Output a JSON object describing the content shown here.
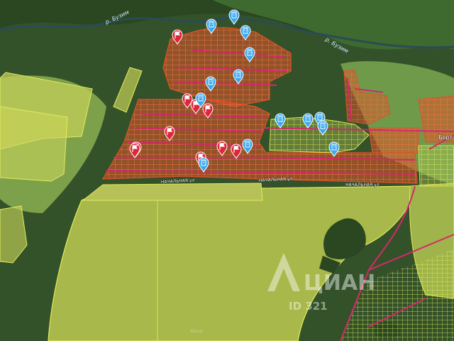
{
  "map": {
    "rivers": [
      "р. Бузим",
      "р. Бузим"
    ],
    "streets": [
      "НАЧАЛЬНАЯ ул",
      "НАЧАЛЬНАЯ ул",
      "НАЧАЛЬНАЯ ул"
    ],
    "place_label": "Борт",
    "watermark": {
      "text": "ЦИАН",
      "id_text": "ID 321"
    },
    "attribution": "Maxar",
    "colors": {
      "plots": "#e0522a",
      "roads": "#d6286b",
      "zones": "#d9e85a",
      "marker_red": "#e0243a",
      "marker_blue": "#3aa8ee"
    },
    "markers": {
      "sold": [
        {
          "icon": "flag-icon"
        },
        {
          "icon": "flag-icon"
        },
        {
          "icon": "flag-icon"
        },
        {
          "icon": "flag-icon"
        },
        {
          "icon": "flag-icon"
        },
        {
          "icon": "flag-icon"
        },
        {
          "icon": "flag-icon"
        },
        {
          "icon": "flag-icon"
        },
        {
          "icon": "flag-icon"
        },
        {
          "icon": "flag-icon"
        }
      ],
      "listings": [
        {
          "icon": "building-icon"
        },
        {
          "icon": "building-icon"
        },
        {
          "icon": "building-icon"
        },
        {
          "icon": "building-icon"
        },
        {
          "icon": "building-icon"
        },
        {
          "icon": "building-icon"
        },
        {
          "icon": "building-icon"
        },
        {
          "icon": "building-icon"
        },
        {
          "icon": "building-icon"
        },
        {
          "icon": "building-icon"
        },
        {
          "icon": "building-icon"
        },
        {
          "icon": "building-icon"
        },
        {
          "icon": "building-icon"
        },
        {
          "icon": "building-icon"
        }
      ]
    }
  }
}
